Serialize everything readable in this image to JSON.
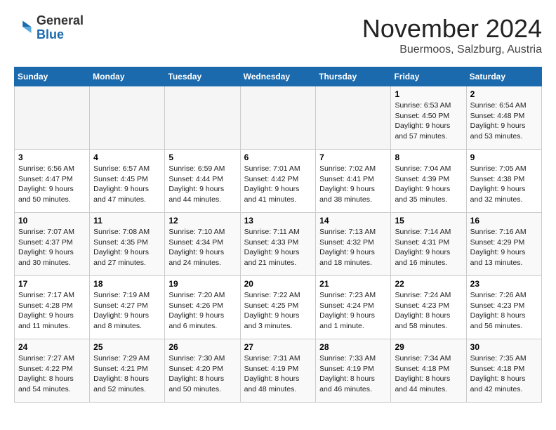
{
  "header": {
    "logo_general": "General",
    "logo_blue": "Blue",
    "month": "November 2024",
    "location": "Buermoos, Salzburg, Austria"
  },
  "days_of_week": [
    "Sunday",
    "Monday",
    "Tuesday",
    "Wednesday",
    "Thursday",
    "Friday",
    "Saturday"
  ],
  "weeks": [
    [
      {
        "day": "",
        "info": ""
      },
      {
        "day": "",
        "info": ""
      },
      {
        "day": "",
        "info": ""
      },
      {
        "day": "",
        "info": ""
      },
      {
        "day": "",
        "info": ""
      },
      {
        "day": "1",
        "info": "Sunrise: 6:53 AM\nSunset: 4:50 PM\nDaylight: 9 hours\nand 57 minutes."
      },
      {
        "day": "2",
        "info": "Sunrise: 6:54 AM\nSunset: 4:48 PM\nDaylight: 9 hours\nand 53 minutes."
      }
    ],
    [
      {
        "day": "3",
        "info": "Sunrise: 6:56 AM\nSunset: 4:47 PM\nDaylight: 9 hours\nand 50 minutes."
      },
      {
        "day": "4",
        "info": "Sunrise: 6:57 AM\nSunset: 4:45 PM\nDaylight: 9 hours\nand 47 minutes."
      },
      {
        "day": "5",
        "info": "Sunrise: 6:59 AM\nSunset: 4:44 PM\nDaylight: 9 hours\nand 44 minutes."
      },
      {
        "day": "6",
        "info": "Sunrise: 7:01 AM\nSunset: 4:42 PM\nDaylight: 9 hours\nand 41 minutes."
      },
      {
        "day": "7",
        "info": "Sunrise: 7:02 AM\nSunset: 4:41 PM\nDaylight: 9 hours\nand 38 minutes."
      },
      {
        "day": "8",
        "info": "Sunrise: 7:04 AM\nSunset: 4:39 PM\nDaylight: 9 hours\nand 35 minutes."
      },
      {
        "day": "9",
        "info": "Sunrise: 7:05 AM\nSunset: 4:38 PM\nDaylight: 9 hours\nand 32 minutes."
      }
    ],
    [
      {
        "day": "10",
        "info": "Sunrise: 7:07 AM\nSunset: 4:37 PM\nDaylight: 9 hours\nand 30 minutes."
      },
      {
        "day": "11",
        "info": "Sunrise: 7:08 AM\nSunset: 4:35 PM\nDaylight: 9 hours\nand 27 minutes."
      },
      {
        "day": "12",
        "info": "Sunrise: 7:10 AM\nSunset: 4:34 PM\nDaylight: 9 hours\nand 24 minutes."
      },
      {
        "day": "13",
        "info": "Sunrise: 7:11 AM\nSunset: 4:33 PM\nDaylight: 9 hours\nand 21 minutes."
      },
      {
        "day": "14",
        "info": "Sunrise: 7:13 AM\nSunset: 4:32 PM\nDaylight: 9 hours\nand 18 minutes."
      },
      {
        "day": "15",
        "info": "Sunrise: 7:14 AM\nSunset: 4:31 PM\nDaylight: 9 hours\nand 16 minutes."
      },
      {
        "day": "16",
        "info": "Sunrise: 7:16 AM\nSunset: 4:29 PM\nDaylight: 9 hours\nand 13 minutes."
      }
    ],
    [
      {
        "day": "17",
        "info": "Sunrise: 7:17 AM\nSunset: 4:28 PM\nDaylight: 9 hours\nand 11 minutes."
      },
      {
        "day": "18",
        "info": "Sunrise: 7:19 AM\nSunset: 4:27 PM\nDaylight: 9 hours\nand 8 minutes."
      },
      {
        "day": "19",
        "info": "Sunrise: 7:20 AM\nSunset: 4:26 PM\nDaylight: 9 hours\nand 6 minutes."
      },
      {
        "day": "20",
        "info": "Sunrise: 7:22 AM\nSunset: 4:25 PM\nDaylight: 9 hours\nand 3 minutes."
      },
      {
        "day": "21",
        "info": "Sunrise: 7:23 AM\nSunset: 4:24 PM\nDaylight: 9 hours\nand 1 minute."
      },
      {
        "day": "22",
        "info": "Sunrise: 7:24 AM\nSunset: 4:23 PM\nDaylight: 8 hours\nand 58 minutes."
      },
      {
        "day": "23",
        "info": "Sunrise: 7:26 AM\nSunset: 4:23 PM\nDaylight: 8 hours\nand 56 minutes."
      }
    ],
    [
      {
        "day": "24",
        "info": "Sunrise: 7:27 AM\nSunset: 4:22 PM\nDaylight: 8 hours\nand 54 minutes."
      },
      {
        "day": "25",
        "info": "Sunrise: 7:29 AM\nSunset: 4:21 PM\nDaylight: 8 hours\nand 52 minutes."
      },
      {
        "day": "26",
        "info": "Sunrise: 7:30 AM\nSunset: 4:20 PM\nDaylight: 8 hours\nand 50 minutes."
      },
      {
        "day": "27",
        "info": "Sunrise: 7:31 AM\nSunset: 4:19 PM\nDaylight: 8 hours\nand 48 minutes."
      },
      {
        "day": "28",
        "info": "Sunrise: 7:33 AM\nSunset: 4:19 PM\nDaylight: 8 hours\nand 46 minutes."
      },
      {
        "day": "29",
        "info": "Sunrise: 7:34 AM\nSunset: 4:18 PM\nDaylight: 8 hours\nand 44 minutes."
      },
      {
        "day": "30",
        "info": "Sunrise: 7:35 AM\nSunset: 4:18 PM\nDaylight: 8 hours\nand 42 minutes."
      }
    ]
  ]
}
